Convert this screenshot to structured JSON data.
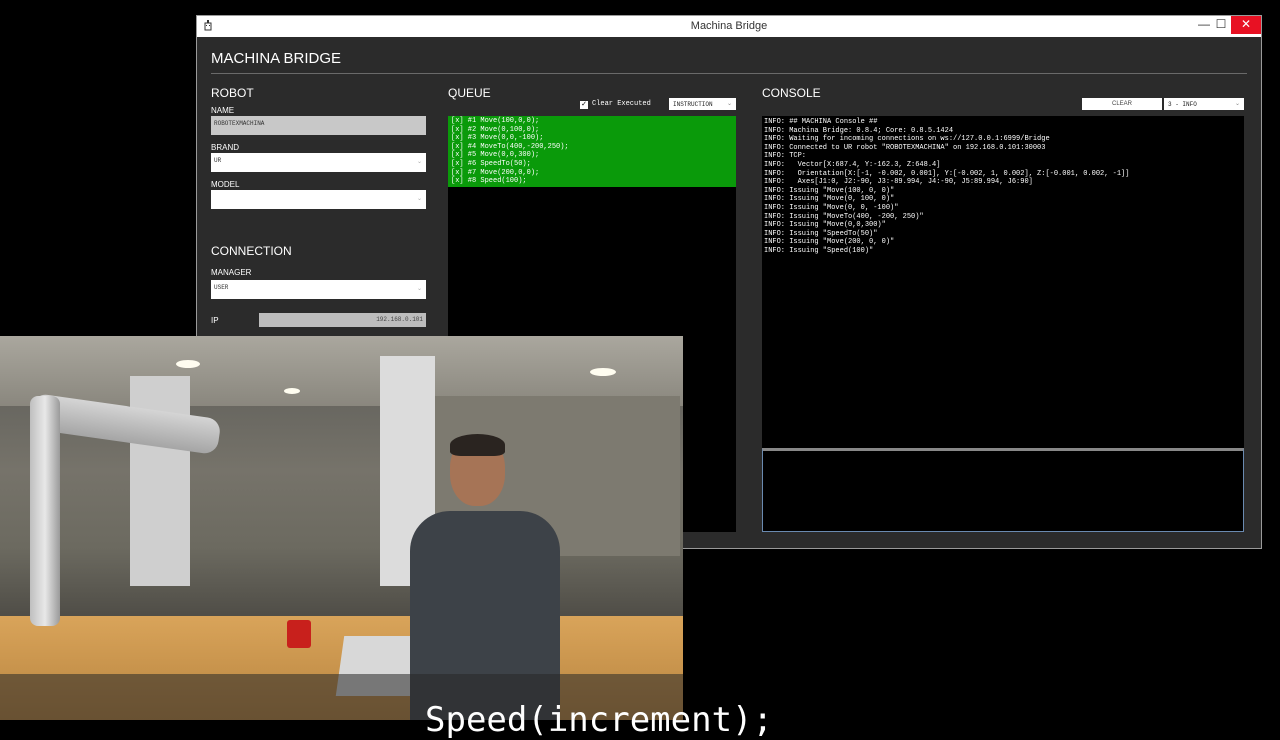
{
  "window": {
    "title": "Machina Bridge",
    "controls": {
      "minimize": "—",
      "maximize": "☐",
      "close": "✕"
    }
  },
  "app_heading": "MACHINA BRIDGE",
  "robot": {
    "section": "ROBOT",
    "name_label": "NAME",
    "name_value": "ROBOTEXMACHINA",
    "brand_label": "BRAND",
    "brand_value": "UR",
    "model_label": "MODEL",
    "model_value": ""
  },
  "connection": {
    "section": "CONNECTION",
    "manager_label": "MANAGER",
    "manager_value": "USER",
    "ip_label": "IP",
    "ip_value": "192.168.0.101"
  },
  "queue": {
    "section": "QUEUE",
    "clear_executed_label": "Clear Executed",
    "clear_executed_checked": true,
    "mode_select": "INSTRUCTION",
    "items": [
      "[x] #1 Move(100,0,0);",
      "[x] #2 Move(0,100,0);",
      "[x] #3 Move(0,0,-100);",
      "[x] #4 MoveTo(400,-200,250);",
      "[x] #5 Move(0,0,300);",
      "[x] #6 SpeedTo(50);",
      "[x] #7 Move(200,0,0);",
      "[x] #8 Speed(100);"
    ]
  },
  "console": {
    "section": "CONSOLE",
    "clear_button": "CLEAR",
    "level_select": "3 - INFO",
    "lines": [
      "INFO: ## MACHINA Console ##",
      "INFO: Machina Bridge: 0.8.4; Core: 0.8.5.1424",
      "INFO: Waiting for incoming connections on ws://127.0.0.1:6999/Bridge",
      "INFO: Connected to UR robot \"ROBOTEXMACHINA\" on 192.168.0.101:30003",
      "INFO: TCP:",
      "INFO:   Vector[X:687.4, Y:-162.3, Z:648.4]",
      "INFO:   Orientation[X:[-1, -0.002, 0.001], Y:[-0.002, 1, 0.002], Z:[-0.001, 0.002, -1]]",
      "INFO:   Axes[J1:0, J2:-90, J3:-89.994, J4:-90, J5:89.994, J6:90]",
      "INFO: Issuing \"Move(100, 0, 0)\"",
      "INFO: Issuing \"Move(0, 100, 0)\"",
      "INFO: Issuing \"Move(0, 0, -100)\"",
      "INFO: Issuing \"MoveTo(400, -200, 250)\"",
      "INFO: Issuing \"Move(0,0,300)\"",
      "INFO: Issuing \"SpeedTo(50)\"",
      "INFO: Issuing \"Move(200, 0, 0)\"",
      "INFO: Issuing \"Speed(100)\""
    ]
  },
  "subtitle": "Speed(increment);"
}
